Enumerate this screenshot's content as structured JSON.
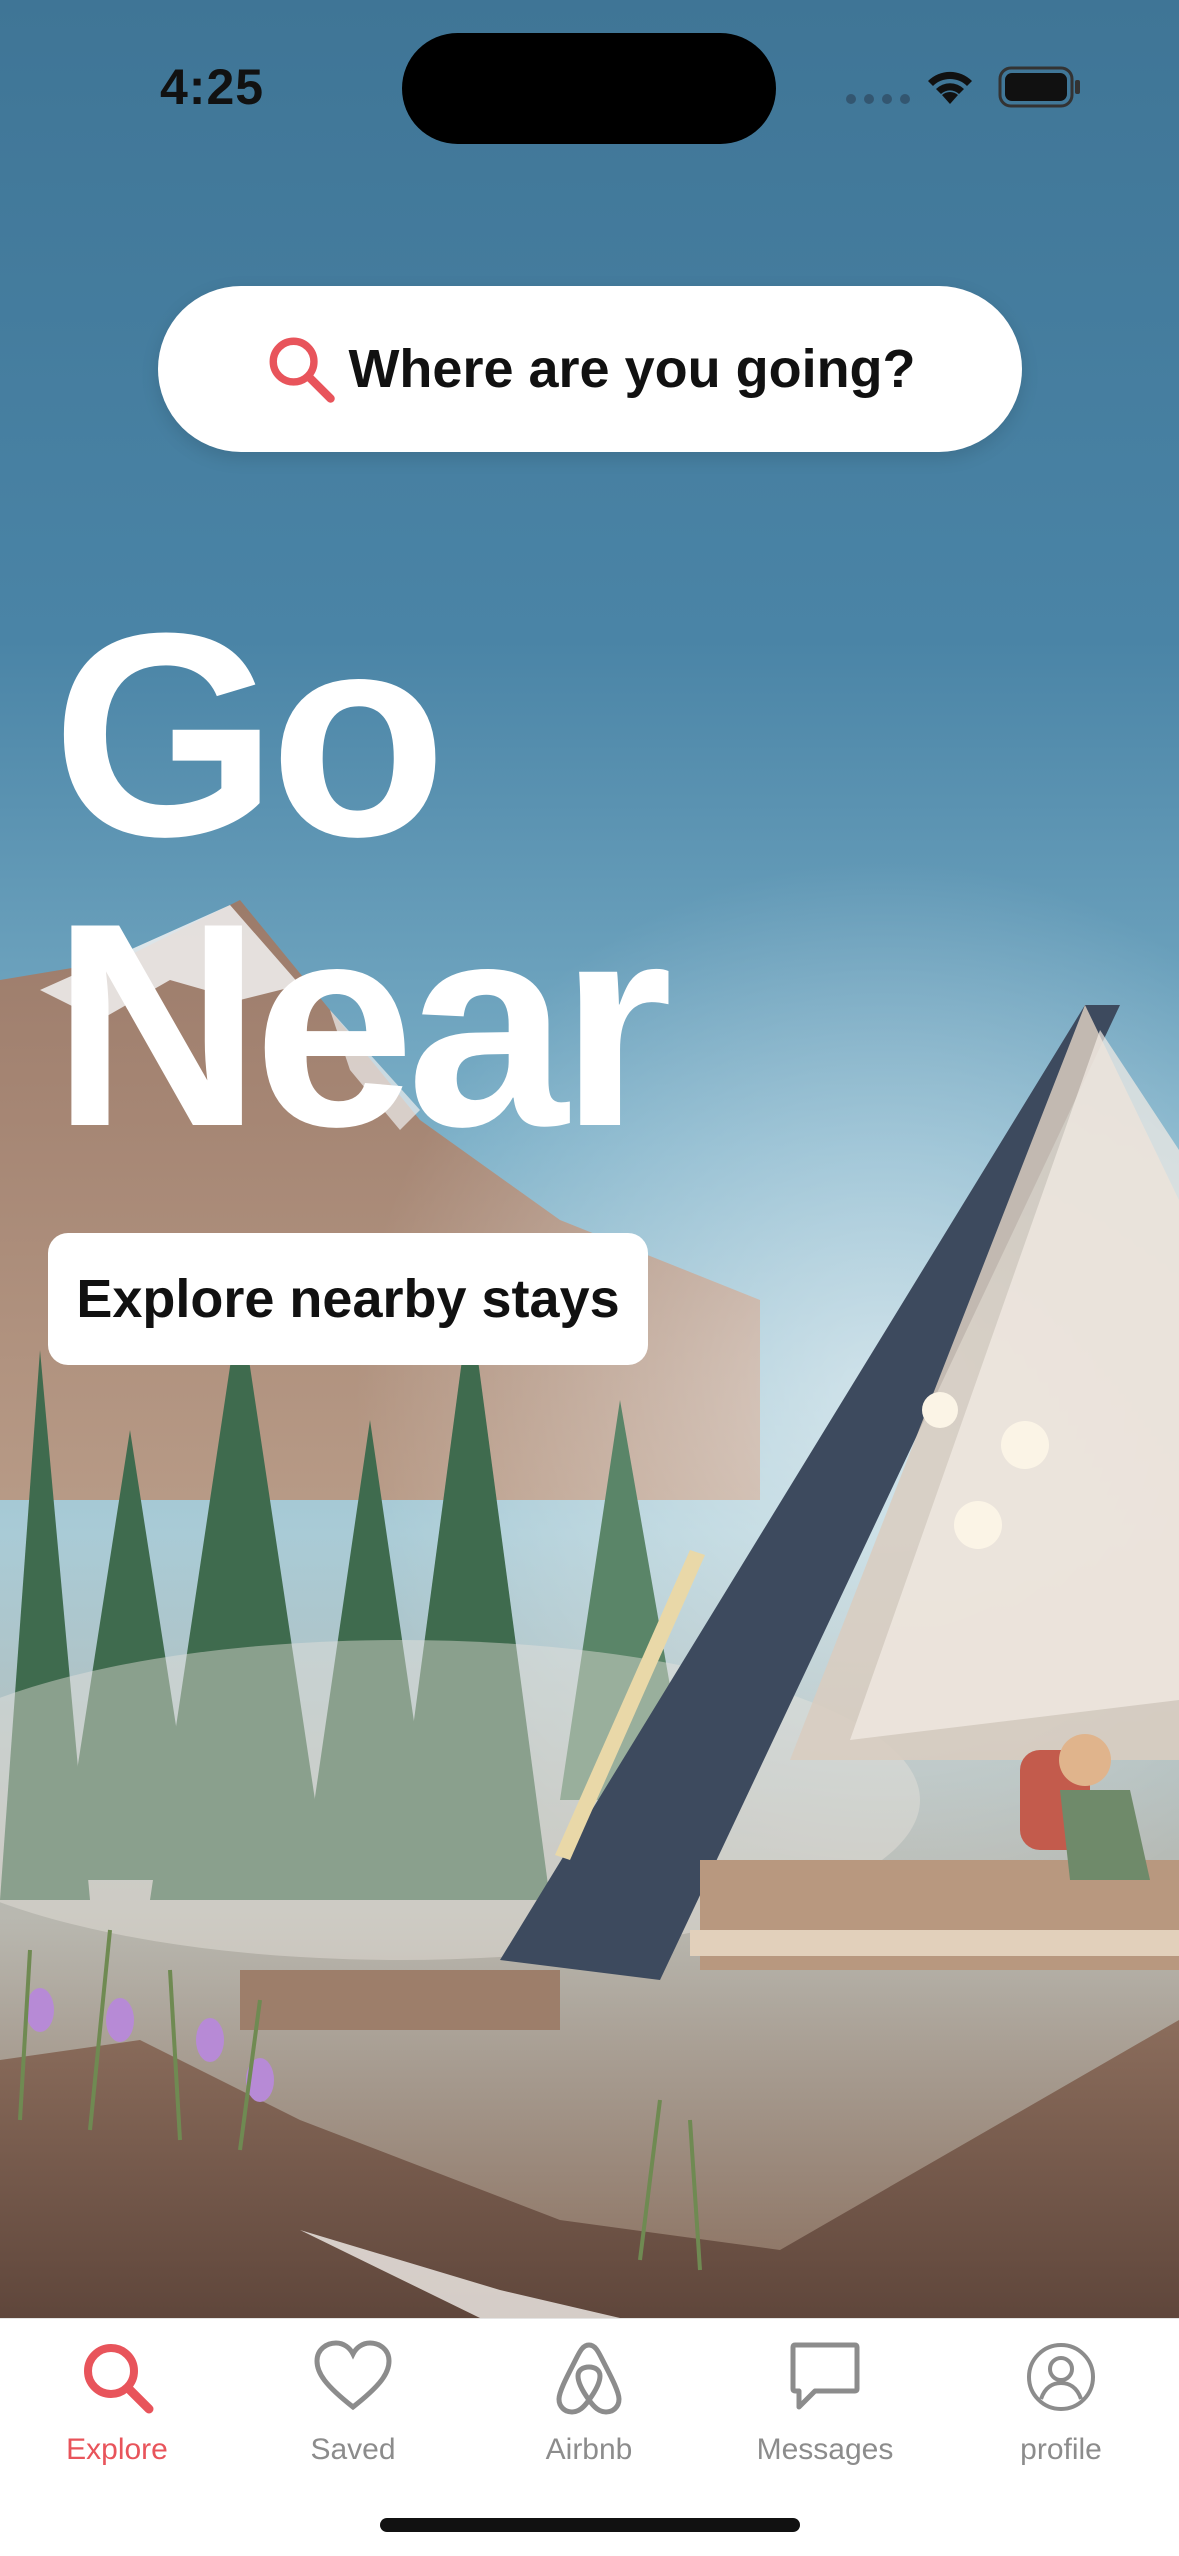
{
  "status_bar": {
    "time": "4:25"
  },
  "search": {
    "placeholder": "Where are you going?",
    "icon": "search-icon"
  },
  "hero": {
    "headline_line1": "Go",
    "headline_line2": "Near",
    "cta_label": "Explore nearby stays"
  },
  "tab_bar": {
    "items": [
      {
        "label": "Explore",
        "icon": "search-icon",
        "active": true
      },
      {
        "label": "Saved",
        "icon": "heart-icon",
        "active": false
      },
      {
        "label": "Airbnb",
        "icon": "airbnb-logo-icon",
        "active": false
      },
      {
        "label": "Messages",
        "icon": "chat-bubble-icon",
        "active": false
      },
      {
        "label": "profile",
        "icon": "profile-icon",
        "active": false
      }
    ]
  },
  "colors": {
    "accent": "#e8545b",
    "inactive_tab": "#8c8c8c",
    "text": "#111111"
  }
}
